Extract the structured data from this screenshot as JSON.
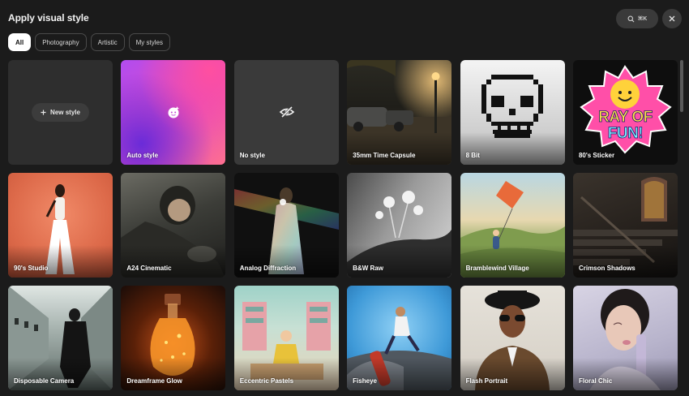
{
  "header": {
    "title": "Apply visual style",
    "search_shortcut": "⌘K",
    "search_icon": "search-icon",
    "close_icon": "close-icon"
  },
  "filters": [
    "All",
    "Photography",
    "Artistic",
    "My styles"
  ],
  "active_filter": "All",
  "new_style": {
    "label": "New style",
    "icon": "plus-icon"
  },
  "styles": [
    {
      "label": "Auto style",
      "icon": "sparkle-face-icon"
    },
    {
      "label": "No style",
      "icon": "eye-off-icon"
    },
    {
      "label": "35mm Time Capsule"
    },
    {
      "label": "8 Bit"
    },
    {
      "label": "80's Sticker",
      "sticker_text_1": "RAY OF",
      "sticker_text_2": "FUN!"
    },
    {
      "label": "90's Studio"
    },
    {
      "label": "A24 Cinematic"
    },
    {
      "label": "Analog Diffraction"
    },
    {
      "label": "B&W Raw"
    },
    {
      "label": "Bramblewind Village"
    },
    {
      "label": "Crimson Shadows"
    },
    {
      "label": "Disposable Camera"
    },
    {
      "label": "Dreamframe Glow"
    },
    {
      "label": "Eccentric Pastels"
    },
    {
      "label": "Fisheye"
    },
    {
      "label": "Flash Portrait"
    },
    {
      "label": "Floral Chic"
    }
  ]
}
